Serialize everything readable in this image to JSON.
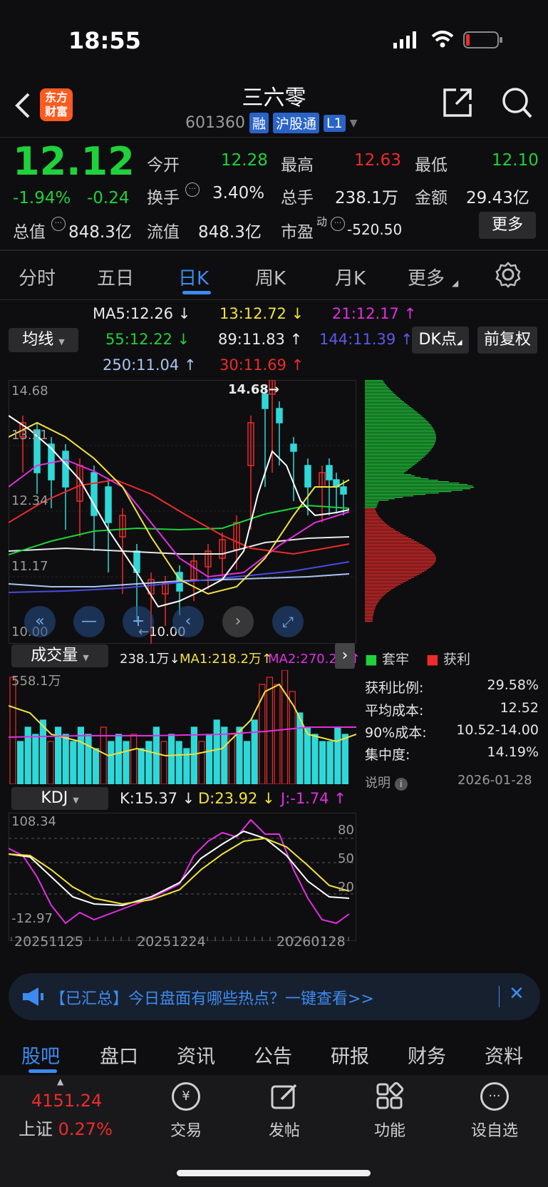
{
  "status": {
    "time": "18:55"
  },
  "header": {
    "title": "三六零",
    "code": "601360",
    "tags": [
      "融",
      "沪股通",
      "L1"
    ],
    "logo_text": "东方\n财富"
  },
  "quote": {
    "price": "12.12",
    "change_pct": "-1.94%",
    "change_abs": "-0.24",
    "open_label": "今开",
    "open": "12.28",
    "high_label": "最高",
    "high": "12.63",
    "low_label": "最低",
    "low": "12.10",
    "turnover_label": "换手",
    "turnover": "3.40%",
    "volume_label": "总手",
    "volume": "238.1万",
    "amount_label": "金额",
    "amount": "29.43亿",
    "mktcap_label": "总值",
    "mktcap": "848.3亿",
    "float_label": "流值",
    "float": "848.3亿",
    "pe_label": "市盈",
    "pe_sup": "动",
    "pe": "-520.50",
    "more": "更多"
  },
  "period_tabs": [
    "分时",
    "五日",
    "日K",
    "周K",
    "月K",
    "更多"
  ],
  "ma_panel": {
    "selector": "均线",
    "ma5": "MA5:12.26",
    "ma13": "13:12.72",
    "ma21": "21:12.17",
    "ma55": "55:12.22",
    "ma89": "89:11.83",
    "ma144": "144:11.39",
    "ma250": "250:11.04",
    "ma30": "30:11.69",
    "dk_btn": "DK点",
    "adj_btn": "前复权"
  },
  "kline": {
    "y_labels": [
      "14.68",
      "13.51",
      "12.34",
      "11.17",
      "10.00"
    ],
    "high_mark": "14.68→",
    "low_mark": "←10.00"
  },
  "chip": {
    "legend_trapped": "套牢",
    "legend_profit": "获利",
    "rows": [
      {
        "label": "获利比例:",
        "value": "29.58%"
      },
      {
        "label": "平均成本:",
        "value": "12.52"
      },
      {
        "label": "90%成本:",
        "value": "10.52-14.00"
      },
      {
        "label": "集中度:",
        "value": "14.19%"
      }
    ],
    "note_label": "说明",
    "note_date": "2026-01-28"
  },
  "volume": {
    "selector": "成交量",
    "vol": "238.1万",
    "ma1": "MA1:218.2万",
    "ma2": "MA2:270.2万",
    "max_label": "558.1万"
  },
  "kdj": {
    "selector": "KDJ",
    "k": "K:15.37",
    "d": "D:23.92",
    "j": "J:-1.74",
    "top": "108.34",
    "bottom": "-12.97",
    "lv80": "80",
    "lv50": "50",
    "lv20": "20"
  },
  "x_dates": [
    "20251125",
    "20251224",
    "20260128"
  ],
  "notice": {
    "text": "【已汇总】今日盘面有哪些热点？一键查看>>"
  },
  "bottom_tabs": [
    "股吧",
    "盘口",
    "资讯",
    "公告",
    "研报",
    "财务",
    "资料"
  ],
  "bottom_nav": {
    "index_value": "4151.24",
    "index_name": "上证",
    "index_pct": "0.27%",
    "items": [
      "交易",
      "发帖",
      "功能",
      "设自选"
    ]
  },
  "colors": {
    "up": "#ee2b2b",
    "down": "#1fd13a",
    "accent": "#3d8bf0",
    "candle_down": "#2fd8d8",
    "ma5": "#ffffff",
    "ma13": "#f2e23a",
    "ma21": "#e22fe2"
  }
}
